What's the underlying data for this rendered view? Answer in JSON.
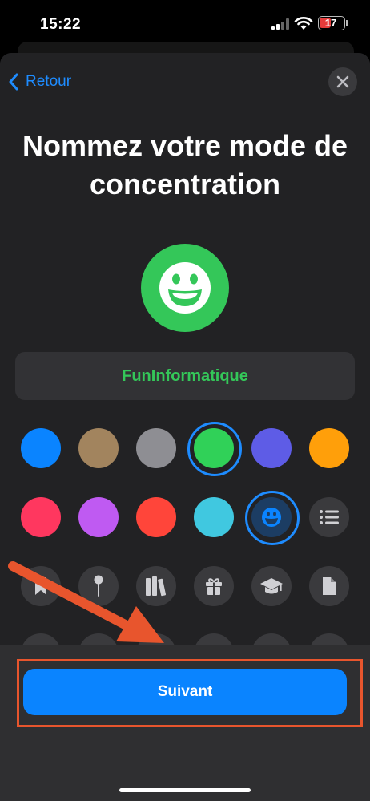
{
  "status_bar": {
    "time": "15:22",
    "battery": "17"
  },
  "nav": {
    "back_label": "Retour"
  },
  "title": "Nommez votre mode de concentration",
  "name_field": {
    "value": "FunInformatique"
  },
  "colors": {
    "row1": [
      "#0a84ff",
      "#a2845e",
      "#8e8e93",
      "#30d158",
      "#5e5ce6",
      "#ff9f0a"
    ],
    "row2": [
      "#ff375f",
      "#bf5af2",
      "#ff453a",
      "#40c8e0"
    ],
    "selected": "#30d158",
    "accent": "#0a84ff"
  },
  "icons": {
    "row2": [
      "smiley-icon",
      "list-icon"
    ],
    "row3": [
      "bookmark-icon",
      "pin-icon",
      "books-icon",
      "gift-icon",
      "graduation-cap-icon",
      "document-icon"
    ],
    "selected": "smiley-icon"
  },
  "footer": {
    "next_label": "Suivant"
  }
}
